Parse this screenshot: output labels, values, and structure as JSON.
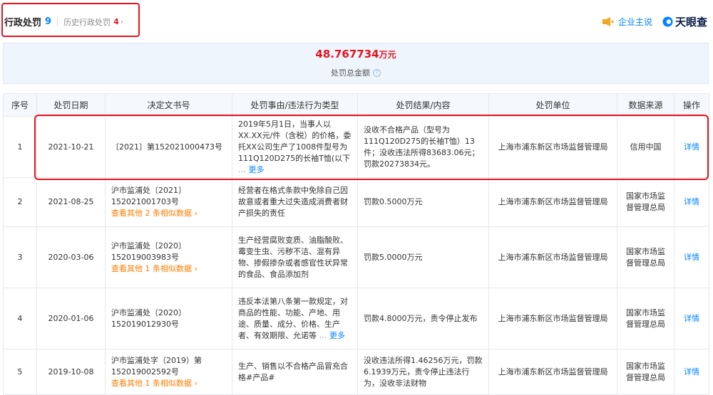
{
  "header": {
    "tab_title": "行政处罚",
    "tab_count": "9",
    "history_label": "历史行政处罚",
    "history_count": "4",
    "history_chevron": "›",
    "brand_link": "企业主说",
    "logo_text": "天眼查"
  },
  "summary": {
    "amount": "48.767734",
    "unit": "万元",
    "label": "处罚总金额",
    "info_icon": "?"
  },
  "table": {
    "headers": [
      "序号",
      "处罚日期",
      "决定文书号",
      "处罚事由/违法行为类型",
      "处罚结果/内容",
      "处罚单位",
      "数据来源",
      "操作"
    ],
    "rows": [
      {
        "index": "1",
        "date": "2021-10-21",
        "doc_no": "〔2021〕第152021000473号",
        "similar": "",
        "reason": "2019年5月1日，当事人以XX.XX元/件（含税）的价格，委托XX公司生产了1008件型号为111Q120D275的长袖T恤(以下",
        "reason_tail": "…",
        "reason_more": "更多",
        "result": "没收不合格产品（型号为111Q120D275的长袖T恤）13件；没收违法所得83683.06元；罚款20273834元。",
        "unit": "上海市浦东新区市场监督管理局",
        "source": "信用中国",
        "action": "详情"
      },
      {
        "index": "2",
        "date": "2021-08-25",
        "doc_no": "沪市监浦处〔2021〕152021001703号",
        "similar": "查看其他 2 条相似数据 ›",
        "reason": "经营者在格式条款中免除自己因故意或者重大过失造成消费者财产损失的责任",
        "reason_tail": "",
        "reason_more": "",
        "result": "罚款0.5000万元",
        "unit": "上海市浦东新区市场监督管理局",
        "source": "国家市场监督管理总局",
        "action": "详情"
      },
      {
        "index": "3",
        "date": "2020-03-06",
        "doc_no": "沪市监浦处〔2020〕152019003983号",
        "similar": "查看其他 1 条相似数据 ›",
        "reason": "生产经营腐败变质、油脂酸败、霉变生虫、污秽不洁、混有异物、掺假掺杂或者感官性状异常的食品、食品添加剂",
        "reason_tail": "",
        "reason_more": "",
        "result": "罚款5.0000万元",
        "unit": "上海市浦东新区市场监督管理局",
        "source": "国家市场监督管理总局",
        "action": "详情"
      },
      {
        "index": "4",
        "date": "2020-01-06",
        "doc_no": "沪市监浦处〔2020〕152019012930号",
        "similar": "",
        "reason": "违反本法第八条第一款规定，对商品的性能、功能、产地、用途、质量、成分、价格、生产者、有效期限、允诺等",
        "reason_tail": "…",
        "reason_more": "更多",
        "result": "罚款4.8000万元，责令停止发布",
        "unit": "上海市浦东新区市场监督管理局",
        "source": "国家市场监督管理总局",
        "action": "详情"
      },
      {
        "index": "5",
        "date": "2019-10-08",
        "doc_no": "沪市监浦处字（2019）第152019002592号",
        "similar": "查看其他 1 条相似数据 ›",
        "reason": "生产、销售以不合格产品冒充合格#产品#",
        "reason_tail": "",
        "reason_more": "",
        "result": "没收违法所得1.46256万元，罚款6.1939万元，责令停止违法行为，没收非法财物",
        "unit": "上海市浦东新区市场监督管理局",
        "source": "国家市场监督管理总局",
        "action": "详情"
      }
    ]
  }
}
